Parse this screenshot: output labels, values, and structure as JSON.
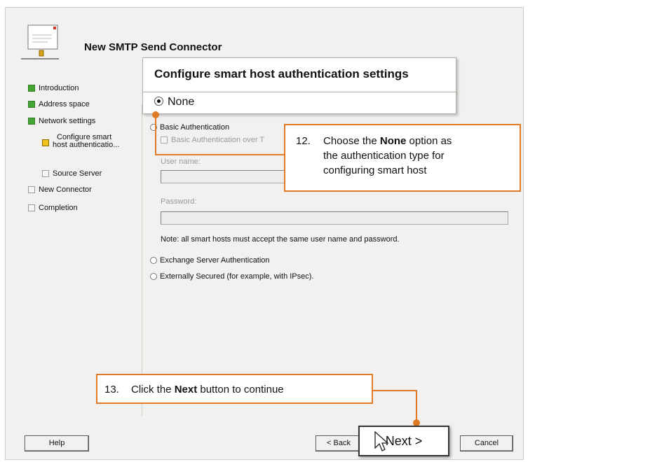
{
  "wizard": {
    "title": "New SMTP Send Connector",
    "steps": [
      {
        "label": "Introduction",
        "state": "done"
      },
      {
        "label": "Address space",
        "state": "done"
      },
      {
        "label": "Network settings",
        "state": "done"
      },
      {
        "label_line1": "Configure smart",
        "label_line2": "host authenticatio...",
        "state": "current"
      },
      {
        "label": "Source Server",
        "state": "pending"
      },
      {
        "label": "New Connector",
        "state": "pending"
      },
      {
        "label": "Completion",
        "state": "pending"
      }
    ],
    "page_title": "Configure smart host authentication settings",
    "options": {
      "none": "None",
      "basic": "Basic Authentication",
      "basic_tls": "Basic Authentication over T",
      "exchange": "Exchange Server Authentication",
      "external": "Externally Secured (for example, with IPsec)."
    },
    "selected_option": "None",
    "username_label": "User name:",
    "username_value": "",
    "password_label": "Password:",
    "password_value": "",
    "note": "Note: all smart hosts must accept the same user name and password.",
    "buttons": {
      "help": "Help",
      "back": "< Back",
      "next": "Next >",
      "cancel": "Cancel"
    }
  },
  "callouts": {
    "step12": {
      "number": "12.",
      "pre": "Choose the ",
      "bold": "None",
      "post1": " option as",
      "line2": "the authentication type for",
      "line3": "configuring smart host"
    },
    "step13": {
      "number": "13.",
      "pre": "Click the ",
      "bold": "Next",
      "post": " button to continue"
    }
  },
  "colors": {
    "accent": "#e07a26",
    "step_done": "#46a634",
    "step_current": "#f0c41c"
  }
}
